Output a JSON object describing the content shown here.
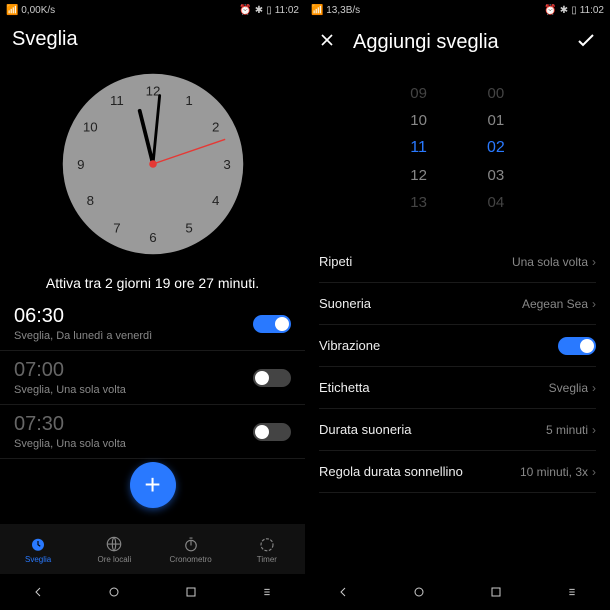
{
  "status": {
    "speed1": "0,00K/s",
    "speed2": "13,3B/s",
    "time": "11:02"
  },
  "left": {
    "title": "Sveglia",
    "next": "Attiva tra 2 giorni 19 ore 27 minuti.",
    "alarms": [
      {
        "time": "06:30",
        "sub": "Sveglia, Da lunedì a venerdì",
        "on": true
      },
      {
        "time": "07:00",
        "sub": "Sveglia, Una sola volta",
        "on": false
      },
      {
        "time": "07:30",
        "sub": "Sveglia, Una sola volta",
        "on": false
      }
    ],
    "tabs": [
      {
        "label": "Sveglia",
        "active": true
      },
      {
        "label": "Ore locali",
        "active": false
      },
      {
        "label": "Cronometro",
        "active": false
      },
      {
        "label": "Timer",
        "active": false
      }
    ],
    "clock": {
      "hour": 11,
      "minute": 2,
      "second": 11
    }
  },
  "right": {
    "title": "Aggiungi sveglia",
    "picker": {
      "hours": [
        "09",
        "10",
        "11",
        "12",
        "13"
      ],
      "minutes": [
        "00",
        "01",
        "02",
        "03",
        "04"
      ],
      "selH": "11",
      "selM": "02"
    },
    "settings": [
      {
        "label": "Ripeti",
        "val": "Una sola volta",
        "type": "link"
      },
      {
        "label": "Suoneria",
        "val": "Aegean Sea",
        "type": "link"
      },
      {
        "label": "Vibrazione",
        "val": "",
        "type": "toggle",
        "on": true
      },
      {
        "label": "Etichetta",
        "val": "Sveglia",
        "type": "link"
      },
      {
        "label": "Durata suoneria",
        "val": "5 minuti",
        "type": "link"
      },
      {
        "label": "Regola durata sonnellino",
        "val": "10 minuti, 3x",
        "type": "link"
      }
    ]
  }
}
